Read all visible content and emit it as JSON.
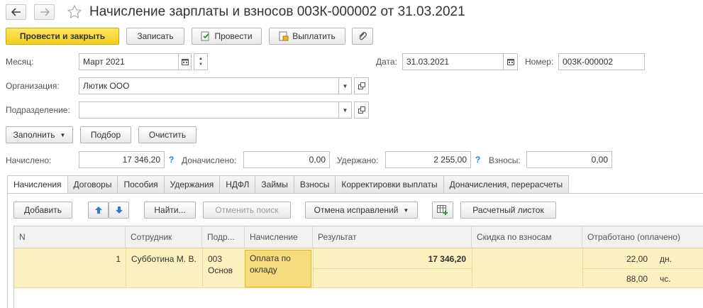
{
  "window": {
    "title": "Начисление зарплаты и взносов 003К-000002 от 31.03.2021"
  },
  "toolbar": {
    "post_close": "Провести и закрыть",
    "save": "Записать",
    "post": "Провести",
    "pay": "Выплатить"
  },
  "form": {
    "month_label": "Месяц:",
    "month_value": "Март 2021",
    "date_label": "Дата:",
    "date_value": "31.03.2021",
    "number_label": "Номер:",
    "number_value": "003К-000002",
    "org_label": "Организация:",
    "org_value": "Лютик ООО",
    "dept_label": "Подразделение:",
    "dept_value": ""
  },
  "actions": {
    "fill": "Заполнить",
    "select": "Подбор",
    "clear": "Очистить"
  },
  "totals": {
    "accrued_label": "Начислено:",
    "accrued_value": "17 346,20",
    "additional_label": "Доначислено:",
    "additional_value": "0,00",
    "withheld_label": "Удержано:",
    "withheld_value": "2 255,00",
    "contrib_label": "Взносы:",
    "contrib_value": "0,00",
    "help": "?"
  },
  "tabs": [
    "Начисления",
    "Договоры",
    "Пособия",
    "Удержания",
    "НДФЛ",
    "Займы",
    "Взносы",
    "Корректировки выплаты",
    "Доначисления, перерасчеты"
  ],
  "table_toolbar": {
    "add": "Добавить",
    "find": "Найти...",
    "cancel_search": "Отменить поиск",
    "cancel_fix": "Отмена исправлений",
    "payslip": "Расчетный листок"
  },
  "table": {
    "columns": [
      "N",
      "Сотрудник",
      "Подр...",
      "Начисление",
      "Результат",
      "Скидка по взносам",
      "Отработано (оплачено)"
    ],
    "rows": [
      {
        "n": "1",
        "employee": "Субботина М. В.",
        "dept": "003 Основ",
        "accrual": "Оплата по окладу",
        "result": "17 346,20",
        "discount": "",
        "days": "22,00",
        "days_unit": "дн.",
        "hours": "88,00",
        "hours_unit": "чс."
      }
    ]
  }
}
